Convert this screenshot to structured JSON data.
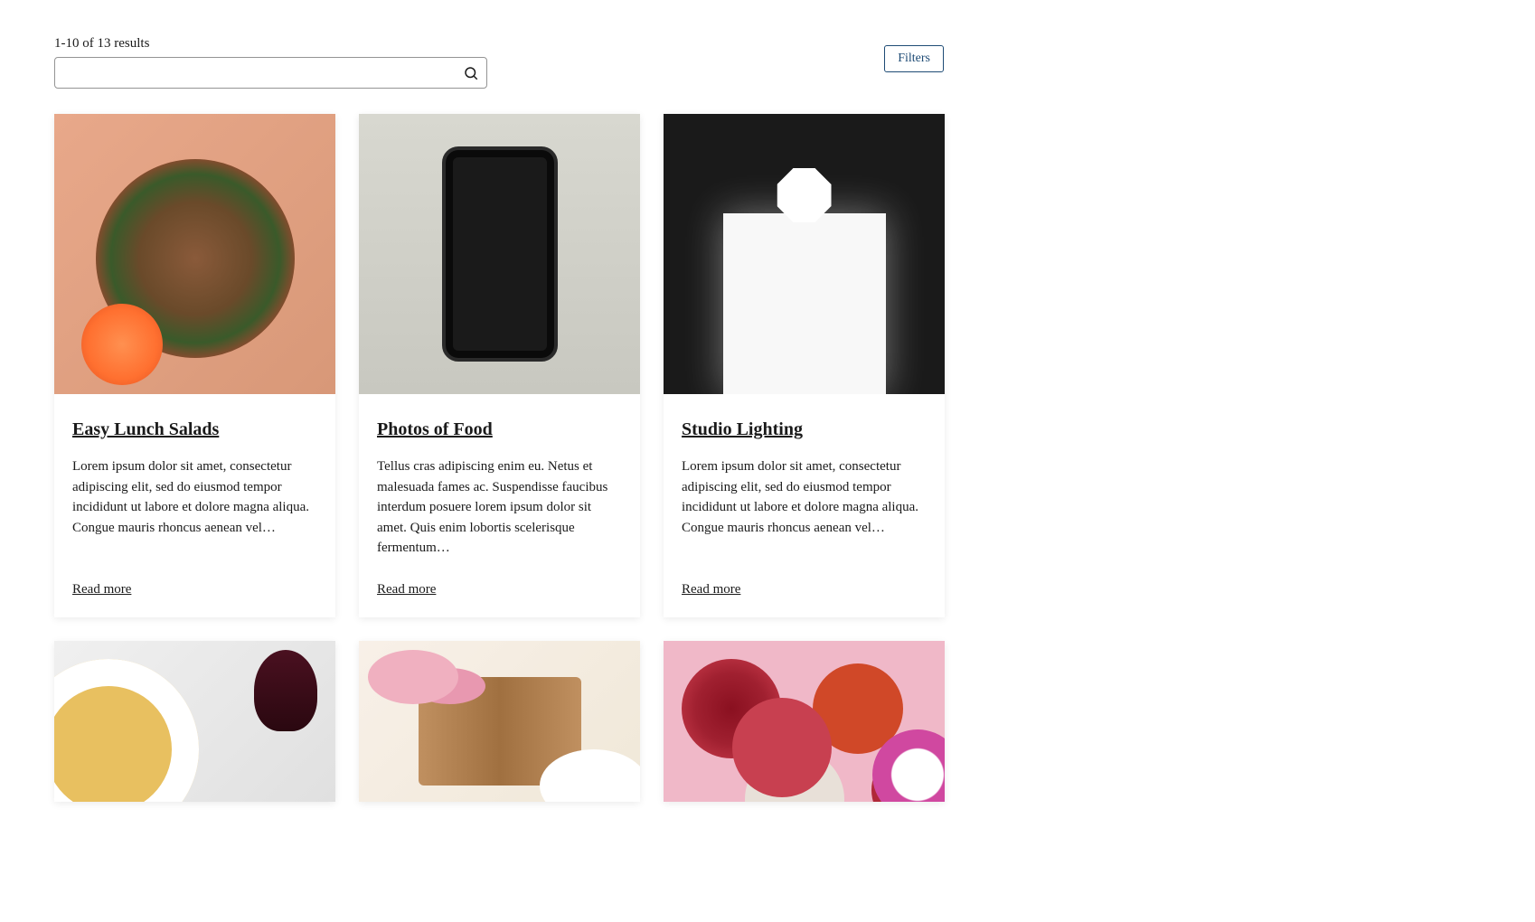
{
  "results_count": "1-10 of 13 results",
  "search": {
    "placeholder": ""
  },
  "filters_label": "Filters",
  "read_more_label": "Read more",
  "cards": [
    {
      "title": "Easy Lunch Salads",
      "excerpt": "Lorem ipsum dolor sit amet, consectetur adipiscing elit, sed do eiusmod tempor incididunt ut labore et dolore magna aliqua. Congue mauris rhoncus aenean vel…",
      "image_class": "img-salad",
      "image_name": "salad-image"
    },
    {
      "title": "Photos of Food",
      "excerpt": "Tellus cras adipiscing enim eu. Netus et malesuada fames ac. Suspendisse faucibus interdum posuere lorem ipsum dolor sit amet. Quis enim lobortis scelerisque fermentum…",
      "image_class": "img-phone",
      "image_name": "phone-food-image"
    },
    {
      "title": "Studio Lighting",
      "excerpt": "Lorem ipsum dolor sit amet, consectetur adipiscing elit, sed do eiusmod tempor incididunt ut labore et dolore magna aliqua. Congue mauris rhoncus aenean vel…",
      "image_class": "img-studio",
      "image_name": "studio-lighting-image"
    },
    {
      "title": "",
      "excerpt": "",
      "image_class": "img-pasta",
      "image_name": "pasta-image",
      "partial": true
    },
    {
      "title": "",
      "excerpt": "",
      "image_class": "img-breakfast",
      "image_name": "breakfast-image",
      "partial": true
    },
    {
      "title": "",
      "excerpt": "",
      "image_class": "img-fruit",
      "image_name": "fruit-image",
      "partial": true
    }
  ]
}
